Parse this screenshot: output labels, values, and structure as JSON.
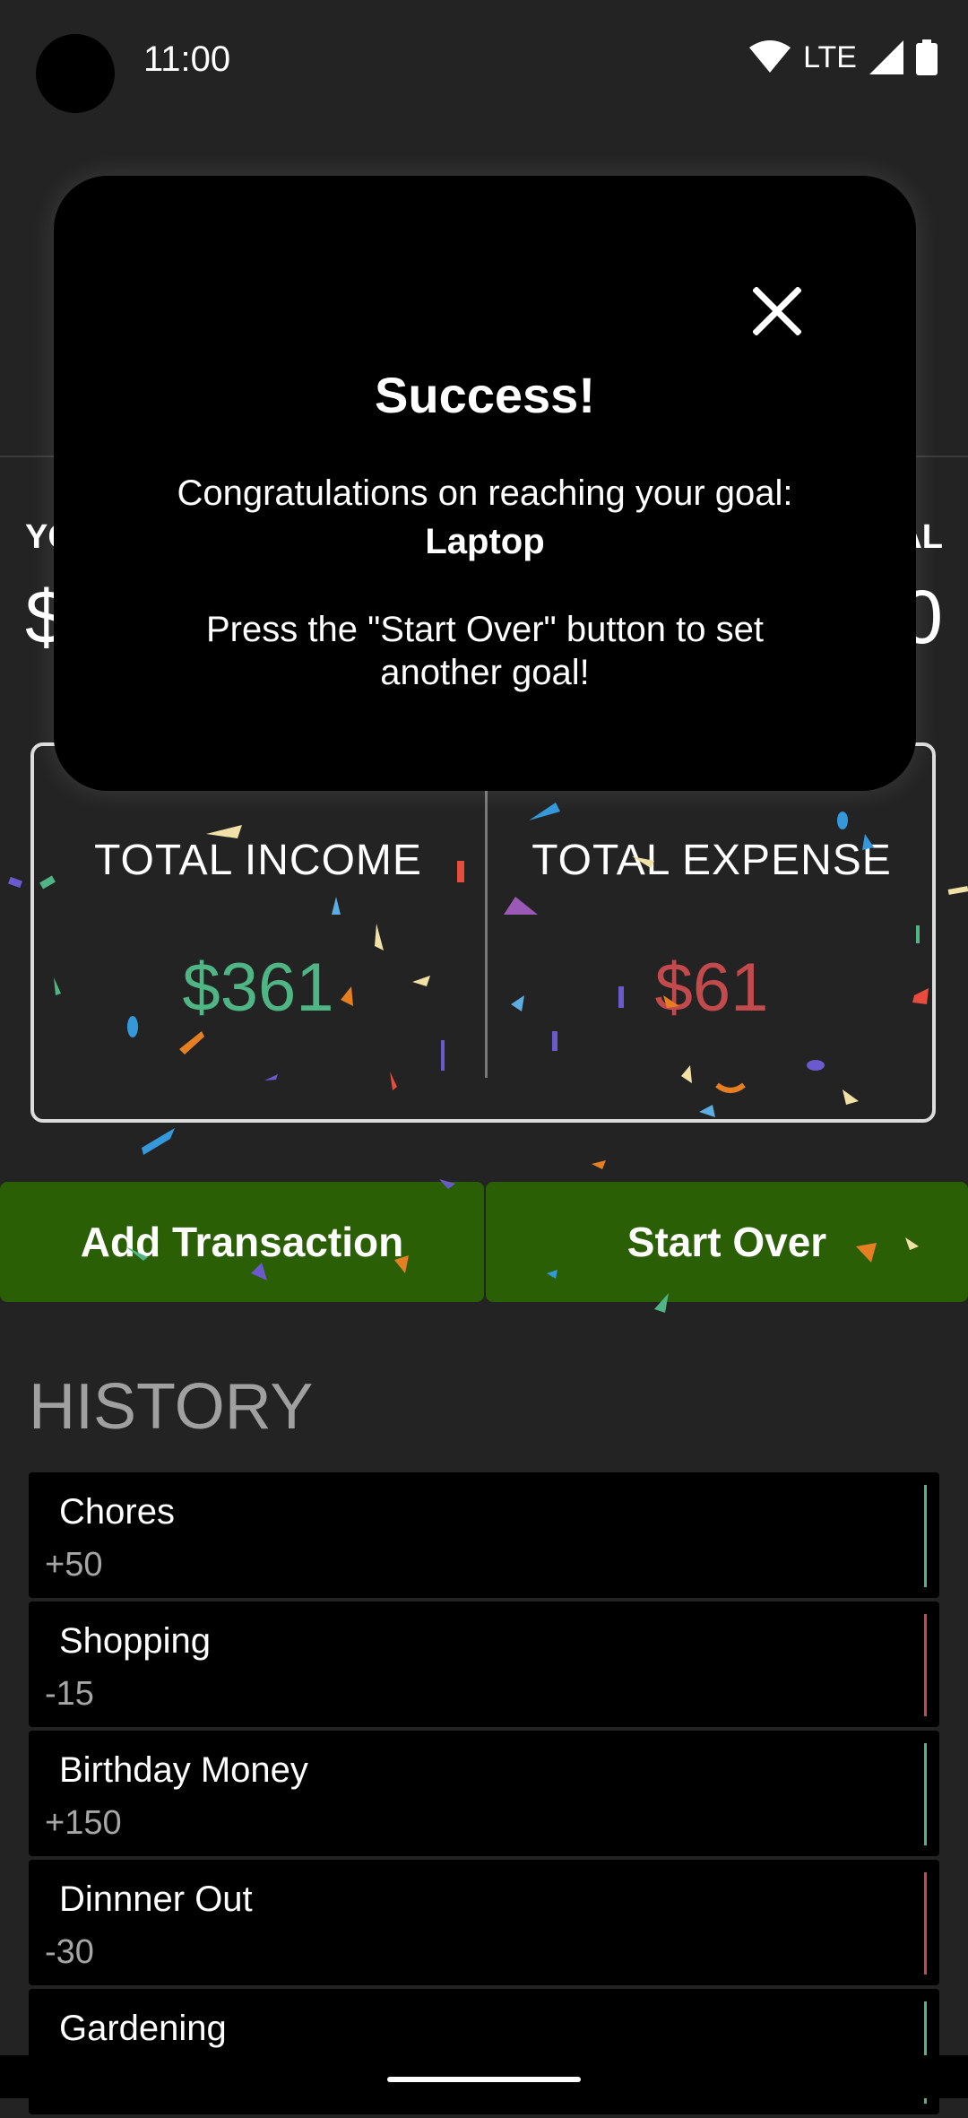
{
  "status_bar": {
    "time": "11:00",
    "network": "LTE"
  },
  "goal": {
    "left_label": "YC",
    "left_value": "$",
    "right_label": "AL",
    "right_value": "0"
  },
  "totals": {
    "income_label": "TOTAL INCOME",
    "income_value": "$361",
    "expense_label": "TOTAL EXPENSE",
    "expense_value": "$61"
  },
  "buttons": {
    "add_transaction": "Add Transaction",
    "start_over": "Start Over"
  },
  "history": {
    "title": "HISTORY",
    "items": [
      {
        "label": "Chores",
        "amount": "+50",
        "type": "income"
      },
      {
        "label": "Shopping",
        "amount": "-15",
        "type": "expense"
      },
      {
        "label": "Birthday Money",
        "amount": "+150",
        "type": "income"
      },
      {
        "label": "Dinnner Out",
        "amount": "-30",
        "type": "expense"
      },
      {
        "label": "Gardening",
        "amount": "",
        "type": "income"
      }
    ]
  },
  "dialog": {
    "title": "Success!",
    "line1": "Congratulations on reaching your goal:",
    "goal_name": "Laptop",
    "line3": "Press the \"Start Over\" button to set",
    "line4": "another goal!"
  },
  "colors": {
    "income": "#4fb584",
    "expense": "#c24a4d",
    "button": "#2a5f05",
    "background": "#232323"
  }
}
